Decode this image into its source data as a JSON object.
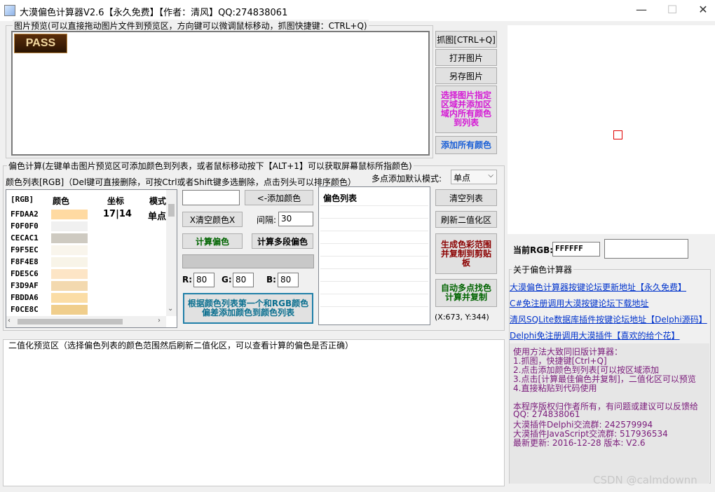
{
  "window": {
    "title": "大漠偏色计算器V2.6【永久免费】【作者：清风】QQ:274838061",
    "controls": {
      "minimize": "—",
      "maximize": "☐",
      "close": "✕"
    }
  },
  "preview": {
    "group_label": "图片预览(可以直接拖动图片文件到预览区，方向键可以微调鼠标移动，抓图快捷键：CTRL+Q)",
    "pass_text": "PASS"
  },
  "right_buttons": {
    "capture": "抓图[CTRL+Q]",
    "open": "打开图片",
    "save_as": "另存图片",
    "select_region": "选择图片指定区域并添加区域内所有颜色到列表",
    "add_all": "添加所有颜色"
  },
  "offset_calc": {
    "group_label": "偏色计算(左键单击图片预览区可添加颜色到列表，或者鼠标移动按下【ALT+1】可以获取屏幕鼠标所指颜色)",
    "list_label": "颜色列表[RGB]（Del键可直接删除，可按Ctrl或者Shift键多选删除，点击列头可以排序颜色）",
    "multi_mode_label": "多点添加默认模式:",
    "multi_mode_value": "单点",
    "columns": [
      "[RGB]",
      "颜色",
      "坐标",
      "模式"
    ],
    "rows": [
      {
        "hex": "FFDAA2",
        "color": "#FFDAA2",
        "coord": "17|14",
        "mode": "单点"
      },
      {
        "hex": "F0F0F0",
        "color": "#F0F0F0",
        "coord": "",
        "mode": ""
      },
      {
        "hex": "CECAC1",
        "color": "#CECAC1",
        "coord": "",
        "mode": ""
      },
      {
        "hex": "F9F5EC",
        "color": "#F9F5EC",
        "coord": "",
        "mode": ""
      },
      {
        "hex": "F8F4E8",
        "color": "#F8F4E8",
        "coord": "",
        "mode": ""
      },
      {
        "hex": "FDE5C6",
        "color": "#FDE5C6",
        "coord": "",
        "mode": ""
      },
      {
        "hex": "F3D9AF",
        "color": "#F3D9AF",
        "coord": "",
        "mode": ""
      },
      {
        "hex": "FBDDA6",
        "color": "#FBDDA6",
        "coord": "",
        "mode": ""
      },
      {
        "hex": "F0CE8C",
        "color": "#F0CE8C",
        "coord": "",
        "mode": ""
      }
    ],
    "add_color_button": "<-添加颜色",
    "clear_color_button": "X清空颜色X",
    "interval_label": "间隔:",
    "interval_value": "30",
    "calc_offset_button": "计算偏色",
    "calc_multi_button": "计算多段偏色",
    "r_label": "R:",
    "r_value": "80",
    "g_label": "G:",
    "g_value": "80",
    "b_label": "B:",
    "b_value": "80",
    "add_by_offset_button": "根据颜色列表第一个和RGB颜色偏差添加颜色到颜色列表",
    "offset_list_header": "偏色列表",
    "clear_list_button": "清空列表",
    "refresh_binary_button": "刷新二值化区",
    "gen_range_button": "生成色彩范围并复制到剪贴板",
    "auto_multi_button": "自动多点找色计算并复制",
    "coords_text": "(X:673, Y:344)"
  },
  "binary": {
    "group_label": "二值化预览区（选择偏色列表的颜色范围然后刷新二值化区，可以查看计算的偏色是否正确）"
  },
  "right_panel": {
    "current_rgb_label": "当前RGB:",
    "current_rgb_value": "FFFFFF",
    "about_label": "关于偏色计算器",
    "links": [
      "大漠偏色计算器按键论坛更新地址【永久免费】",
      "C#免注册调用大漠按键论坛下载地址",
      "清风SQLite数据库插件按键论坛地址【Delphi源码】",
      "Delphi免注册调用大漠插件【喜欢的给个花】"
    ],
    "info_lines": [
      "使用方法大致同旧版计算器：",
      "1.抓图，快捷键[Ctrl+Q]",
      "2.点击添加颜色到列表[可以按区域添加",
      "3.点击[计算最佳偏色并复制]，二值化区可以预览",
      "4.直接粘贴到代码使用",
      "",
      "本程序版权归作者所有，有问题或建议可以反馈给",
      "QQ: 274838061",
      "大漠插件Delphi交流群: 242579994",
      "大漠插件JavaScript交流群: 517936534",
      "最新更新: 2016-12-28 版本: V2.6"
    ]
  },
  "watermark": "CSDN @calmdownn",
  "colors": {
    "magenta": "#d51ad5",
    "dark_red": "#8b0000",
    "green": "#006400",
    "blue": "#1a5fd6",
    "link": "#0033cc",
    "marker": "#e00000"
  }
}
